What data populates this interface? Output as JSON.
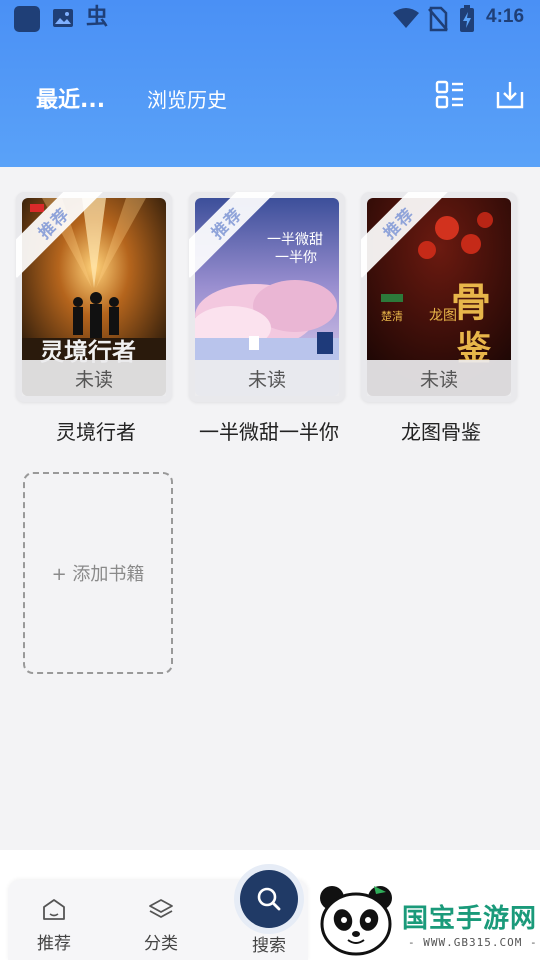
{
  "statusbar": {
    "time": "4:16",
    "bug_glyph": "虫",
    "icons": [
      "app-square-icon",
      "image-icon",
      "bug-icon",
      "wifi-icon",
      "no-sim-icon",
      "battery-charging-icon"
    ]
  },
  "header": {
    "tab_recent": "最近...",
    "tab_history": "浏览历史",
    "icons": [
      "list-grid-icon",
      "download-icon"
    ],
    "accent_color": "#4a90f5"
  },
  "books": [
    {
      "title": "灵境行者",
      "badge": "推荐",
      "status": "未读"
    },
    {
      "title": "一半微甜一半你",
      "badge": "推荐",
      "status": "未读"
    },
    {
      "title": "龙图骨鉴",
      "badge": "推荐",
      "status": "未读"
    }
  ],
  "add_book": {
    "label": "+ 添加书籍"
  },
  "bottom_nav": {
    "items": [
      {
        "label": "推荐",
        "icon": "recommend-icon"
      },
      {
        "label": "分类",
        "icon": "category-layers-icon"
      },
      {
        "label": "搜索",
        "icon": "search-icon"
      }
    ]
  },
  "watermark": {
    "text": "国宝手游网",
    "url": "- WWW.GB315.COM -"
  }
}
